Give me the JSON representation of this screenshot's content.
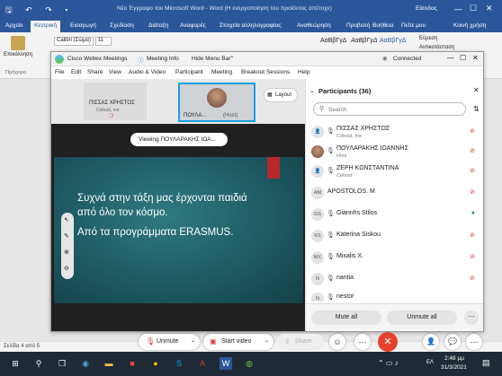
{
  "word": {
    "title": "Νέο Έγγραφο του Microsoft Word - Word (Η ενεργοποίηση του προϊόντος απέτυχε)",
    "quick_access": "🖫 ↶ ↷ ▾",
    "tabs": [
      "Αρχείο",
      "Κεντρική",
      "Εισαγωγή",
      "Σχεδίαση",
      "Διάταξη",
      "Αναφορές",
      "Στοιχεία αλληλογραφίας",
      "Αναθεώρηση",
      "Προβολή",
      "Βοήθεια"
    ],
    "tell_me": "Πείτε μου",
    "signin": "Είσοδος",
    "share": "Κοινή χρήση",
    "ribbon": {
      "paste_label": "Επικόλληση",
      "clipboard_label": "Πρόχειρο",
      "font_name": "Calibri (Σώμα)",
      "font_size": "11",
      "style1": "ΑαΒβΓγΔ",
      "style2": "ΑαΒβΓγΔ",
      "style3": "ΑαΒβΓγΔ",
      "find": "Εύρεση",
      "replace": "Αντικατάσταση"
    },
    "status_page": "Σελίδα 4 από 5"
  },
  "taskbar": {
    "time": "2:48 μμ",
    "date": "31/3/2021",
    "lang": "ΕΛ"
  },
  "webex": {
    "app_title": "Cisco Webex Meetings",
    "meeting_info": "Meeting Info",
    "hide_menu": "Hide Menu Bar",
    "status": "Connected",
    "menu": [
      "File",
      "Edit",
      "Share",
      "View",
      "Audio & Video",
      "Participant",
      "Meeting",
      "Breakout Sessions",
      "Help"
    ],
    "thumb1": {
      "name": "ΠΙΣΣΑΣ ΧΡΗΣΤΟΣ",
      "role": "Cohost, me"
    },
    "thumb2": {
      "name": "ΠΟΥΛΑ...",
      "role": "(Host)"
    },
    "layout": "Layout",
    "viewing_banner": "Viewing ΠΟΥΛΑΡΑΚΗΣ ΙΩΑ...",
    "slide_lines": [
      "Συχνά στην τάξη μας έρχονται παιδιά",
      "από όλο τον κόσμο.",
      "Από τα προγράμματα ERASMUS."
    ],
    "controls": {
      "unmute": "Unmute",
      "start_video": "Start video",
      "share": "Share"
    },
    "participants": {
      "title": "Participants (36)",
      "search_placeholder": "Search",
      "list": [
        {
          "initials": "",
          "name": "ΠΙΣΣΑΣ ΧΡΗΣΤΟΣ",
          "role": "Cohost, me"
        },
        {
          "initials": "",
          "name": "ΠΟΥΛΑΡΑΚΗΣ ΙΩΑΝΝΗΣ",
          "role": "Host"
        },
        {
          "initials": "",
          "name": "ΖΕΡΗ ΚΩΝΣΤΑΝΤΙΝΑ",
          "role": "Cohost"
        },
        {
          "initials": "AM",
          "name": "APOSTOLOS. M",
          "role": ""
        },
        {
          "initials": "GS",
          "name": "Giannhs Stilos",
          "role": ""
        },
        {
          "initials": "KS",
          "name": "Katerina Siskou",
          "role": ""
        },
        {
          "initials": "MX",
          "name": "Mixalis X.",
          "role": ""
        },
        {
          "initials": "N",
          "name": "nantia",
          "role": ""
        },
        {
          "initials": "N",
          "name": "nestor",
          "role": ""
        }
      ],
      "mute_all": "Mute all",
      "unmute_all": "Unmute all"
    }
  }
}
